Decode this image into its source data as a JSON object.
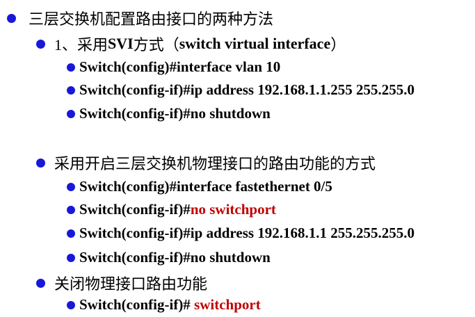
{
  "title": "三层交换机配置路由接口的两种方法",
  "method1": {
    "heading_prefix": "1、采用",
    "heading_bold": "SVI",
    "heading_mid": "方式（",
    "heading_paren": "switch virtual interface",
    "heading_suffix": "）",
    "commands": [
      {
        "text": "Switch(config)#interface vlan 10"
      },
      {
        "text": "Switch(config-if)#ip address 192.168.1.1.255 255.255.0"
      },
      {
        "text": "Switch(config-if)#no shutdown"
      }
    ]
  },
  "method2": {
    "heading": "采用开启三层交换机物理接口的路由功能的方式",
    "cmd1": "Switch(config)#interface fastethernet 0/5",
    "cmd2_prefix": "Switch(config-if)#",
    "cmd2_highlight": "no switchport",
    "cmd3": "Switch(config-if)#ip address 192.168.1.1 255.255.255.0",
    "cmd4": "Switch(config-if)#no shutdown"
  },
  "disable": {
    "heading": "关闭物理接口路由功能",
    "cmd_prefix": "Switch(config-if)# ",
    "cmd_highlight": "switchport"
  },
  "colors": {
    "bullet": "#1818d8",
    "highlight": "#c00000"
  }
}
